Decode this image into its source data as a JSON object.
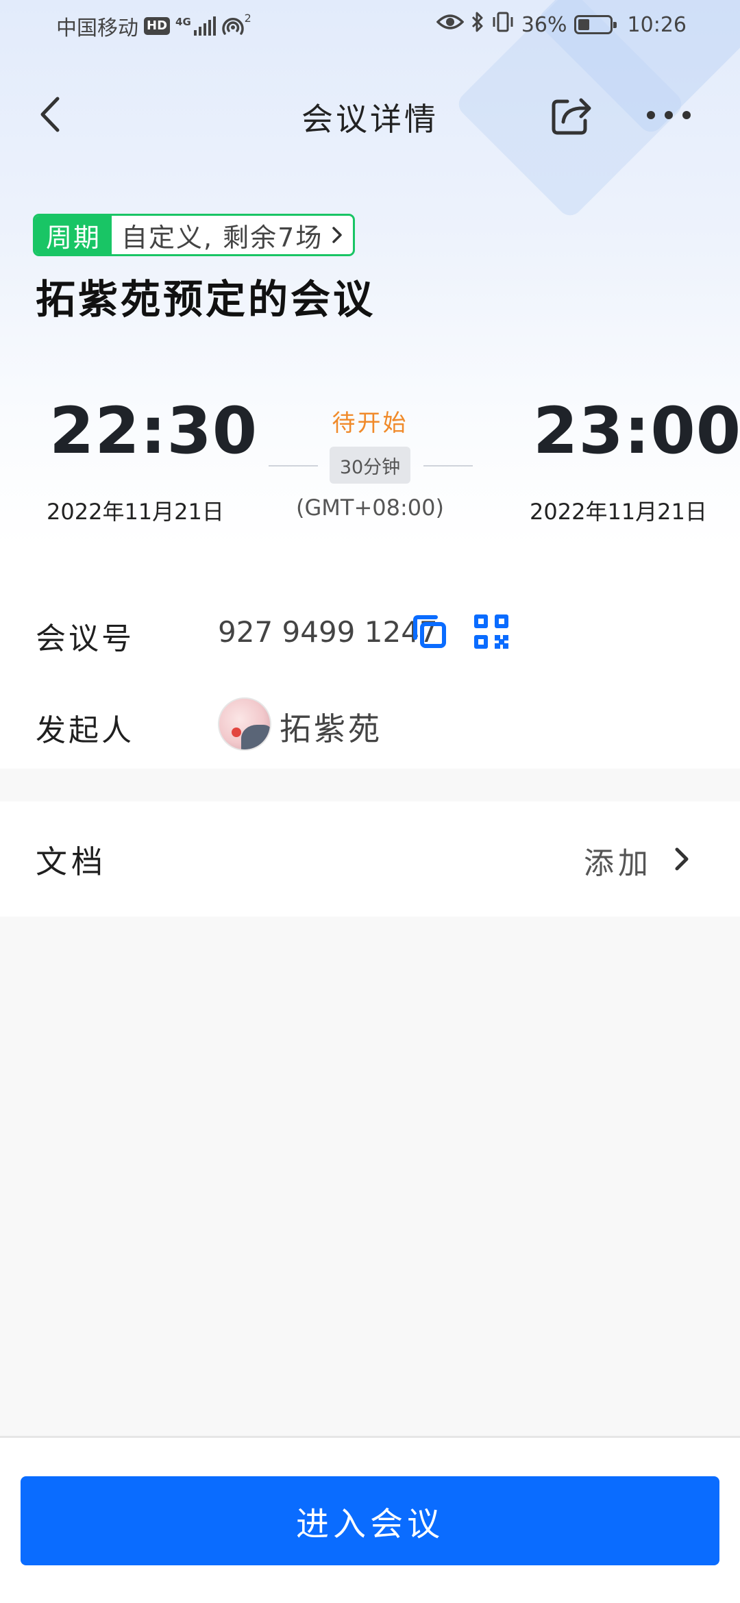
{
  "status_bar": {
    "carrier": "中国移动",
    "hd_badge": "HD",
    "network_type": "4G",
    "hotspot_count": "2",
    "battery_percent": "36%",
    "battery_level": 0.36,
    "time": "10:26",
    "icons": [
      "hd-icon",
      "signal-icon",
      "hotspot-icon",
      "eye-icon",
      "bluetooth-icon",
      "vibrate-icon",
      "battery-icon"
    ]
  },
  "nav": {
    "title": "会议详情",
    "icons": [
      "back-icon",
      "share-icon",
      "more-icon"
    ]
  },
  "recurrence": {
    "badge": "周期",
    "text": "自定义, 剩余7场"
  },
  "meeting": {
    "title": "拓紫苑预定的会议",
    "start_time": "22:30",
    "start_date": "2022年11月21日",
    "end_time": "23:00",
    "end_date": "2022年11月21日",
    "status": "待开始",
    "duration": "30分钟",
    "timezone": "(GMT+08:00)"
  },
  "info": {
    "meeting_id_label": "会议号",
    "meeting_id": "927 9499 1247",
    "host_label": "发起人",
    "host_name": "拓紫苑"
  },
  "documents": {
    "label": "文档",
    "add_label": "添加"
  },
  "actions": {
    "join_label": "进入会议"
  },
  "colors": {
    "accent": "#0a6cff",
    "recurrence_green": "#19c565",
    "status_orange": "#f08a2a"
  }
}
